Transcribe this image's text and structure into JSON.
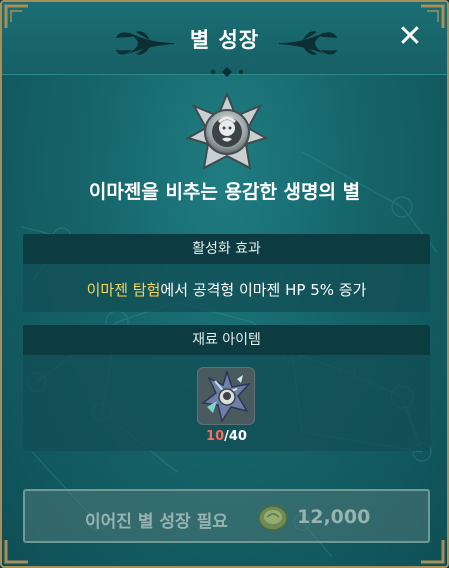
{
  "header": {
    "title": "별 성장",
    "close_icon": "close-icon"
  },
  "star": {
    "emblem_icon": "imagen-star-emblem-icon",
    "name": "이마젠을 비추는 용감한 생명의 별"
  },
  "effect": {
    "header": "활성화 효과",
    "highlight": "이마젠 탐험",
    "text": "에서 공격형 이마젠 HP 5% 증가"
  },
  "materials": {
    "header": "재료 아이템",
    "item_icon": "star-material-icon",
    "owned": "10",
    "required_text": "/40"
  },
  "action": {
    "label": "이어진 별 성장 필요",
    "coin_icon": "coin-icon",
    "cost": "12,000"
  },
  "colors": {
    "panel": "#156469",
    "frame_gold": "#a88e58",
    "highlight": "#f5d55a",
    "count_shortfall": "#ff6a5a",
    "disabled_text": "#97b3b0"
  }
}
